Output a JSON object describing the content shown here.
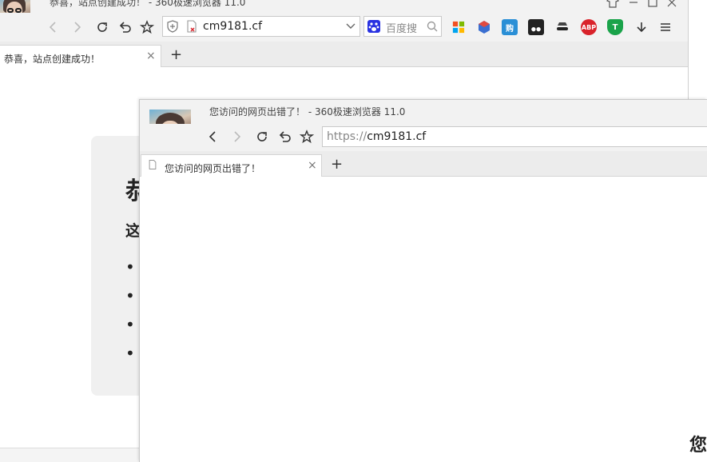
{
  "back_window": {
    "title": "恭喜，站点创建成功！ - 360极速浏览器 11.0",
    "url": "cm9181.cf",
    "search_placeholder": "百度搜",
    "tab_label": "恭喜，站点创建成功！",
    "tab_close": "×",
    "new_tab": "+",
    "page_heading_char": "恭",
    "page_sub_char": "这",
    "bullet_char": "•",
    "extensions": [
      "microsoft-ext",
      "cube-ext",
      "gou-ext",
      "tampermonkey-ext",
      "spy-ext",
      "abp-ext",
      "shield-ext"
    ],
    "abp_label": "ABP",
    "gou_label": "购",
    "shield_label": "T"
  },
  "front_window": {
    "title": "您访问的网页出错了！ - 360极速浏览器 11.0",
    "url_prefix": "https://",
    "url_host": "cm9181.cf",
    "tab_label": "您访问的网页出错了！",
    "tab_close": "×",
    "new_tab": "+",
    "page_edge_char": "您"
  },
  "colors": {
    "abp_red": "#d9232b",
    "shield_green": "#1aa34a",
    "baidu_blue": "#2932e1",
    "accent_gray": "#f2f2f2"
  }
}
